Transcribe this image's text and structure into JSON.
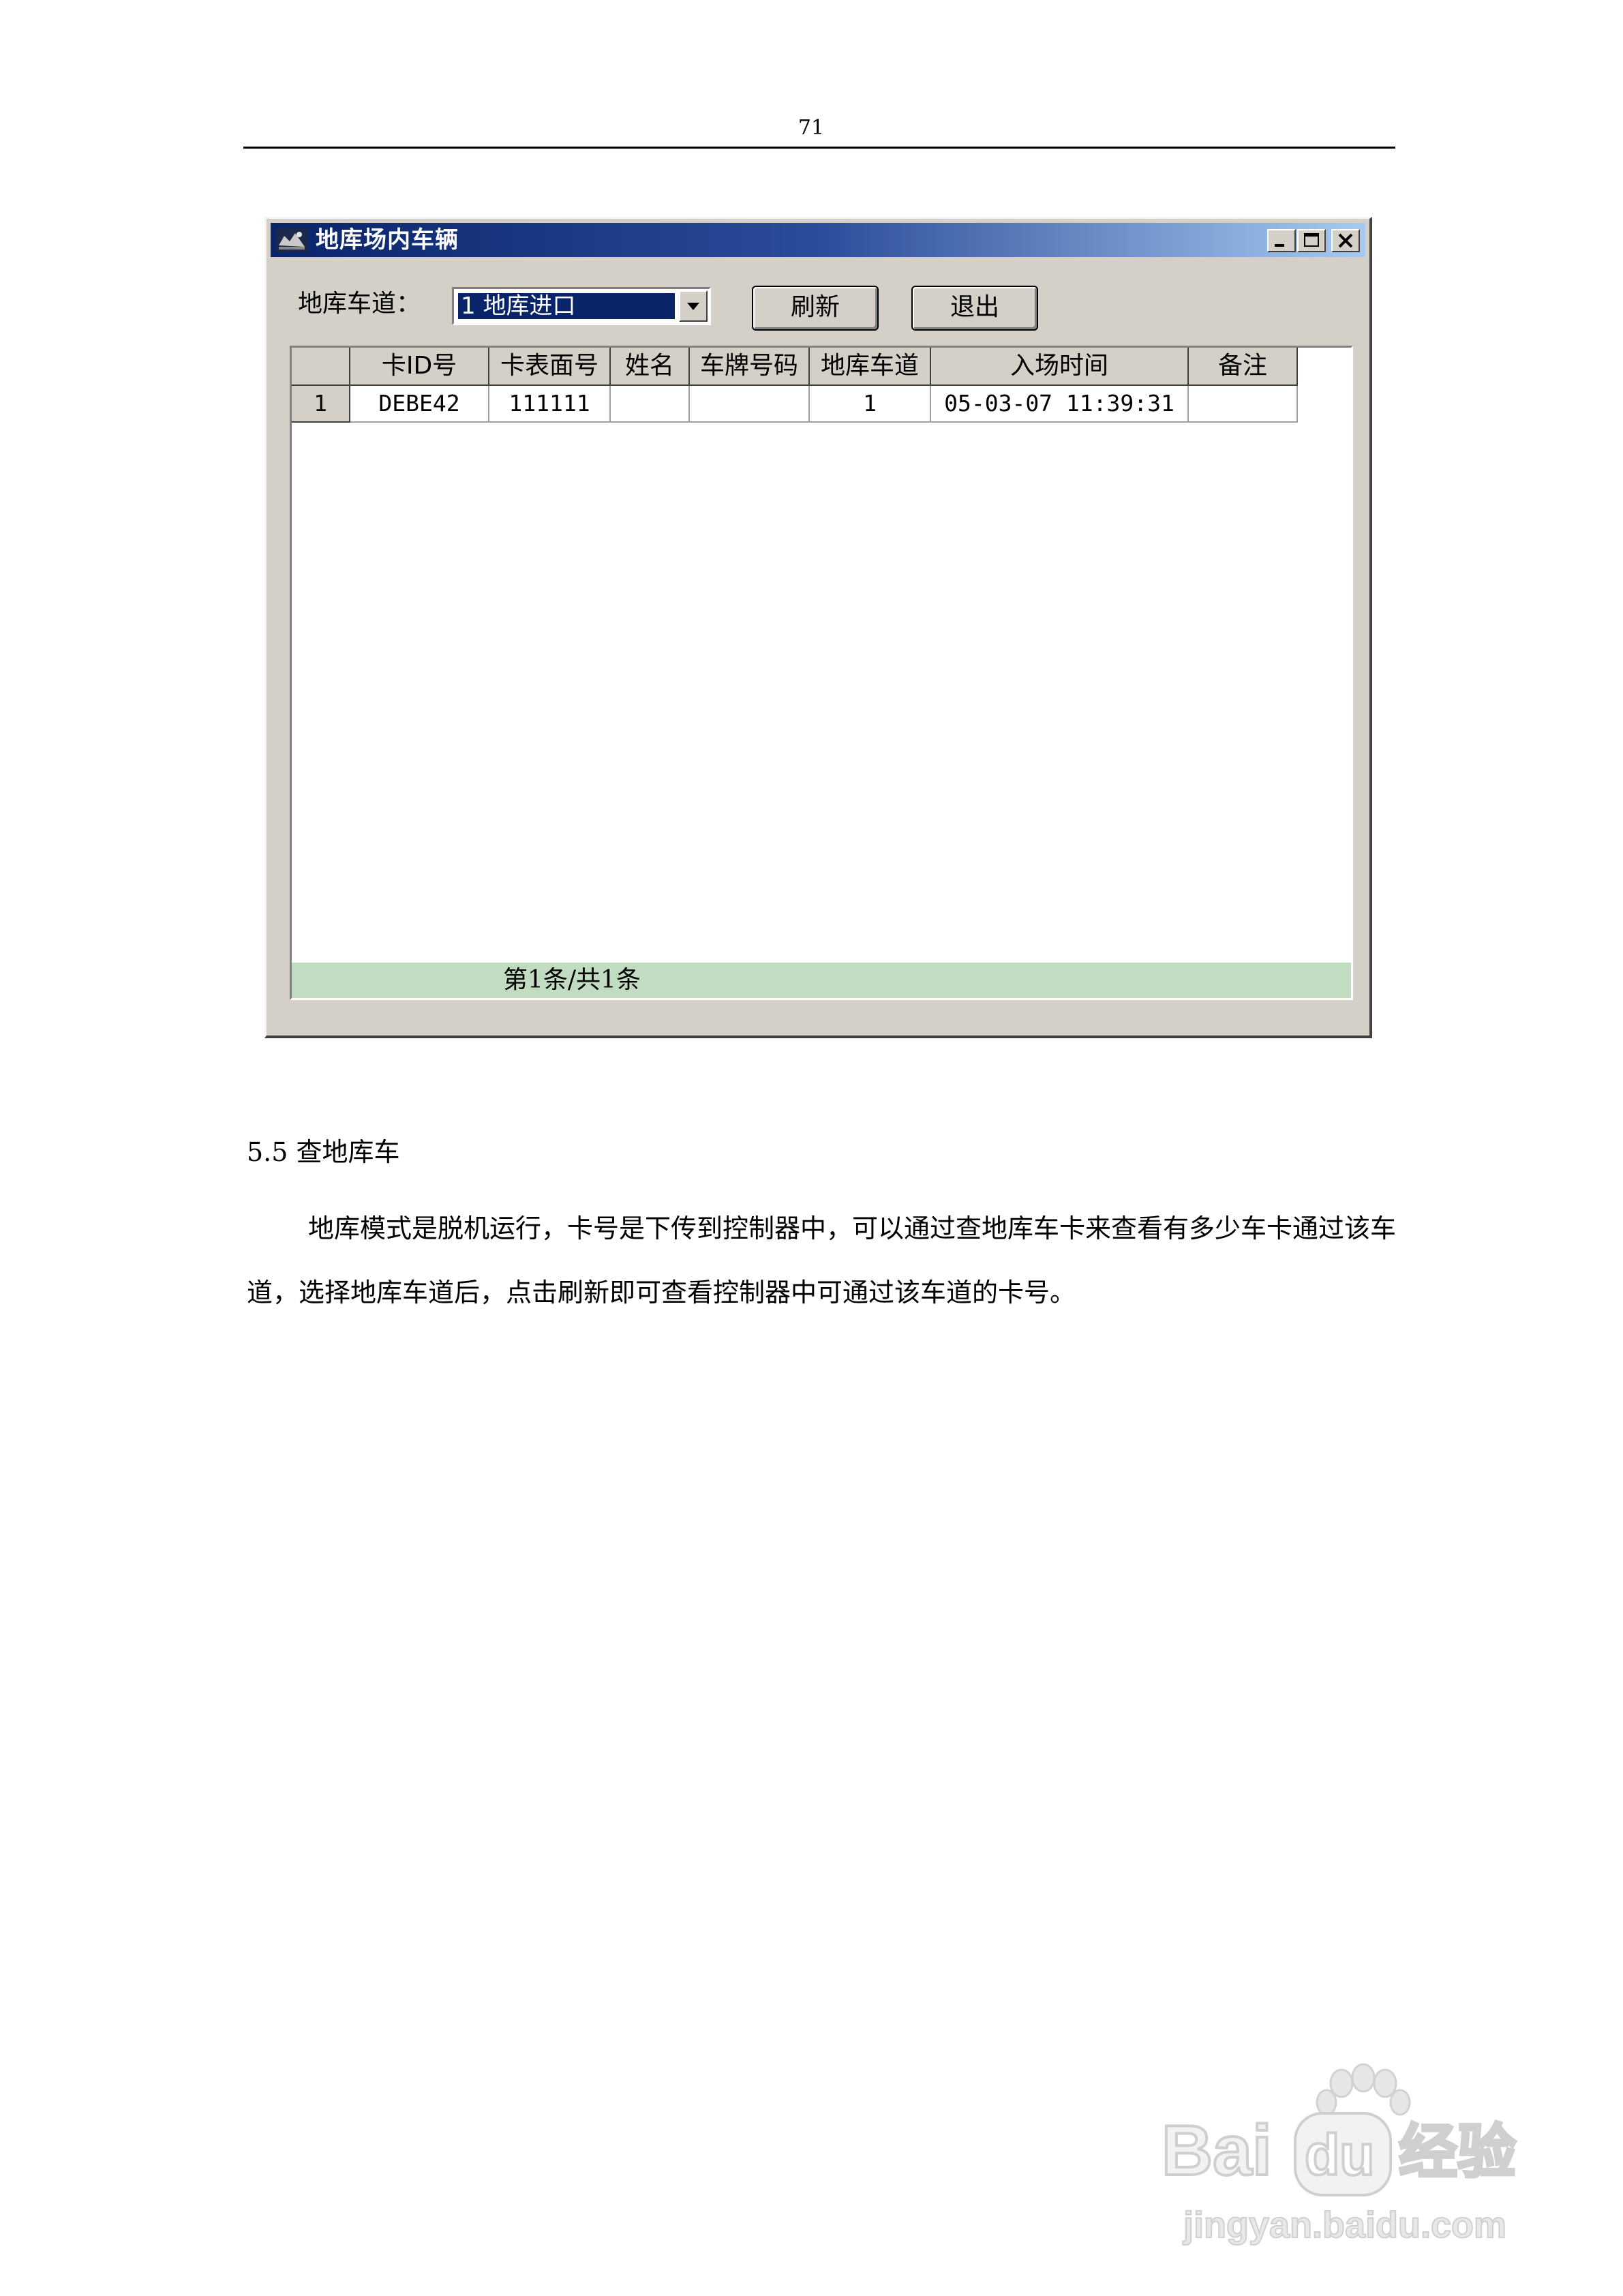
{
  "page": {
    "number": "71"
  },
  "window": {
    "title": "地库场内车辆",
    "lane_label": "地库车道：",
    "lane_selected": "1 地库进口",
    "buttons": {
      "refresh": "刷新",
      "exit": "退出"
    },
    "table": {
      "columns": [
        "卡ID号",
        "卡表面号",
        "姓名",
        "车牌号码",
        "地库车道",
        "入场时间",
        "备注"
      ],
      "rows": [
        {
          "index": "1",
          "card_id": "DEBE42",
          "card_face": "111111",
          "name": "",
          "plate": "",
          "lane": "1",
          "entry_time": "05-03-07 11:39:31",
          "note": ""
        }
      ]
    },
    "status": "第1条/共1条"
  },
  "section": {
    "heading": "5.5 查地库车",
    "paragraph": "地库模式是脱机运行，卡号是下传到控制器中，可以通过查地库车卡来查看有多少车卡通过该车道，选择地库车道后，点击刷新即可查看控制器中可通过该车道的卡号。"
  },
  "watermark": {
    "logo": "Bai du 经验",
    "url": "jingyan.baidu.com"
  }
}
